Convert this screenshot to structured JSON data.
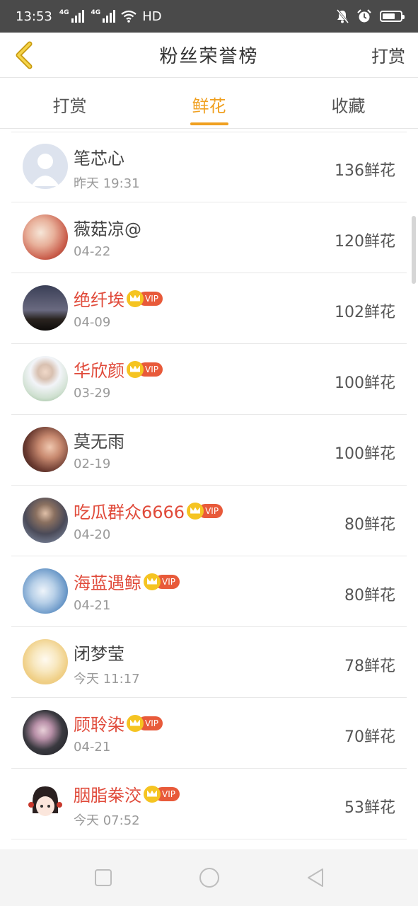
{
  "status_bar": {
    "time": "13:53",
    "network_1": "4G",
    "network_2": "4G",
    "hd_label": "HD",
    "icons": [
      "signal-icon",
      "wifi-icon",
      "mute-icon",
      "alarm-icon",
      "battery-icon"
    ]
  },
  "header": {
    "title": "粉丝荣誉榜",
    "action_label": "打赏",
    "back_icon": "chevron-left-icon",
    "accent_color": "#f0a020"
  },
  "tabs": [
    {
      "label": "打赏",
      "active": false
    },
    {
      "label": "鲜花",
      "active": true
    },
    {
      "label": "收藏",
      "active": false
    }
  ],
  "vip_badge_label": "VIP",
  "fans": [
    {
      "name": "笔芯心",
      "date": "昨天 19:31",
      "count": "136鲜花",
      "vip": false
    },
    {
      "name": "薇菇凉@",
      "date": "04-22",
      "count": "120鲜花",
      "vip": false
    },
    {
      "name": "绝纤埃",
      "date": "04-09",
      "count": "102鲜花",
      "vip": true
    },
    {
      "name": "华欣颜",
      "date": "03-29",
      "count": "100鲜花",
      "vip": true
    },
    {
      "name": "莫无雨",
      "date": "02-19",
      "count": "100鲜花",
      "vip": false
    },
    {
      "name": "吃瓜群众6666",
      "date": "04-20",
      "count": "80鲜花",
      "vip": true
    },
    {
      "name": "海蓝遇鲸",
      "date": "04-21",
      "count": "80鲜花",
      "vip": true
    },
    {
      "name": "闭梦莹",
      "date": "今天 11:17",
      "count": "78鲜花",
      "vip": false
    },
    {
      "name": "顾聆染",
      "date": "04-21",
      "count": "70鲜花",
      "vip": true
    },
    {
      "name": "胭脂桊洨",
      "date": "今天 07:52",
      "count": "53鲜花",
      "vip": true
    }
  ],
  "colors": {
    "vip_name": "#e04a3a",
    "vip_badge": "#e85a3a",
    "crown": "#f5c422"
  },
  "nav_bar": {
    "icons": [
      "recent-apps-icon",
      "home-icon",
      "back-icon"
    ]
  }
}
